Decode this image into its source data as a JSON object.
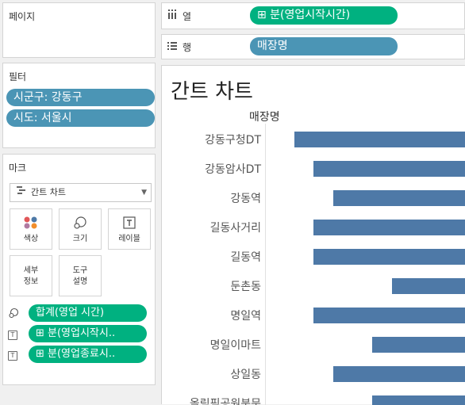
{
  "pages": {
    "title": "페이지"
  },
  "filters": {
    "title": "필터",
    "items": [
      "시군구: 강동구",
      "시도: 서울시"
    ]
  },
  "marks": {
    "title": "마크",
    "mark_type": "간트 차트",
    "buttons": {
      "color": "색상",
      "size": "크기",
      "label": "레이블",
      "detail": "세부\n정보",
      "tooltip": "도구\n설명"
    },
    "fields": [
      "합계(영업 시간)",
      "⊞ 분(영업시작시..",
      "⊞ 분(영업종료시.."
    ]
  },
  "shelves": {
    "columns_label": "열",
    "columns_pill": "⊞ 분(영업시작시간)",
    "rows_label": "행",
    "rows_pill": "매장명"
  },
  "view": {
    "title": "간트 차트",
    "row_header": "매장명"
  },
  "colors": {
    "bar": "#4e79a7",
    "pill_blue": "#4b95b5",
    "pill_green": "#00b180"
  },
  "chart_data": {
    "type": "bar",
    "subtype": "gantt",
    "title": "간트 차트",
    "categories": [
      "강동구청DT",
      "강동암사DT",
      "강동역",
      "길동사거리",
      "길동역",
      "둔촌동",
      "명일역",
      "명일이마트",
      "상일동",
      "올림픽공원북문"
    ],
    "start_rank": [
      1,
      2,
      3,
      2,
      2,
      5,
      2,
      4,
      3,
      4
    ]
  }
}
